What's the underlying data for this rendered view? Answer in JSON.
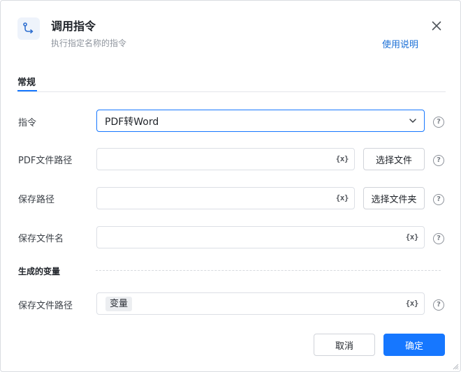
{
  "dialog": {
    "title": "调用指令",
    "subtitle": "执行指定名称的指令",
    "help_link": "使用说明"
  },
  "tabs": [
    {
      "label": "常规",
      "active": true
    }
  ],
  "form": {
    "command": {
      "label": "指令",
      "value": "PDF转Word"
    },
    "pdf_path": {
      "label": "PDF文件路径",
      "value": "",
      "button": "选择文件"
    },
    "save_path": {
      "label": "保存路径",
      "value": "",
      "button": "选择文件夹"
    },
    "save_filename": {
      "label": "保存文件名",
      "value": ""
    },
    "variable_button": "{x}",
    "help_glyph": "?"
  },
  "generated": {
    "section_label": "生成的变量",
    "save_file_path": {
      "label": "保存文件路径",
      "tag": "变量"
    }
  },
  "footer": {
    "cancel": "取消",
    "confirm": "确定"
  },
  "colors": {
    "accent": "#1677ff",
    "link": "#1a6fd6"
  }
}
